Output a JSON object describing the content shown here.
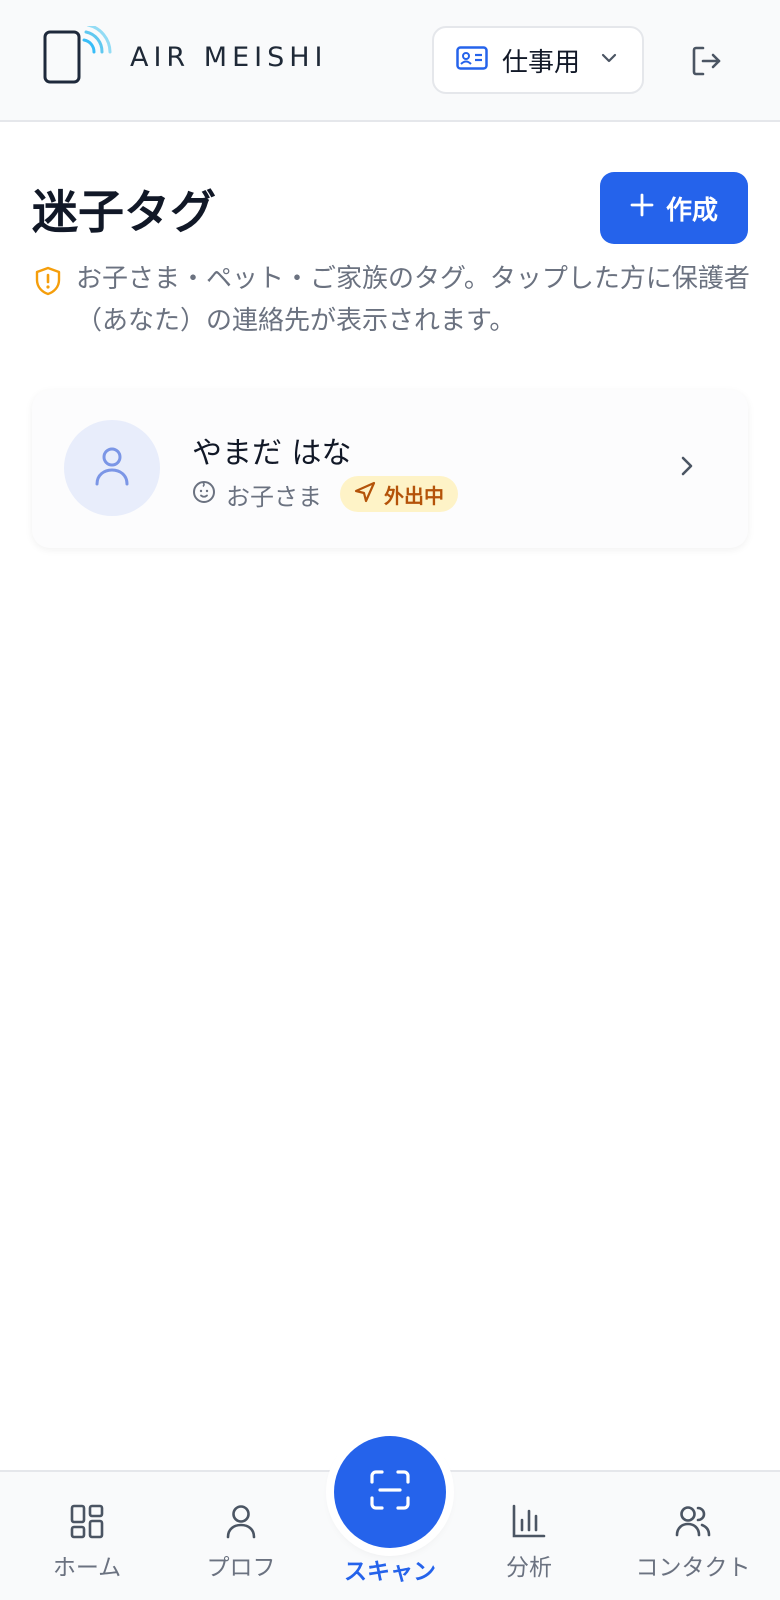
{
  "header": {
    "app_name": "AIR MEISHI",
    "profile_selector": {
      "value": "仕事用",
      "icon": "id-card-icon"
    },
    "logout_icon": "logout-icon"
  },
  "page": {
    "title": "迷子タグ",
    "create_button_label": "作成",
    "notice": "お子さま・ペット・ご家族のタグ。タップした方に保護者（あなた）の連絡先が表示されます。"
  },
  "tags": [
    {
      "name": "やまだ はな",
      "type": "お子さま",
      "status": "外出中"
    }
  ],
  "bottom_nav": {
    "items": [
      {
        "label": "ホーム",
        "icon": "home-grid-icon",
        "active": false
      },
      {
        "label": "プロフ",
        "icon": "user-icon",
        "active": false
      },
      {
        "label": "スキャン",
        "icon": "scan-icon",
        "active": true
      },
      {
        "label": "分析",
        "icon": "bar-chart-icon",
        "active": false
      },
      {
        "label": "コンタクト",
        "icon": "users-icon",
        "active": false
      }
    ]
  },
  "colors": {
    "accent": "#2563eb",
    "warning": "#f59e0b",
    "badge_bg": "#fef3c7",
    "badge_text": "#b45309"
  }
}
